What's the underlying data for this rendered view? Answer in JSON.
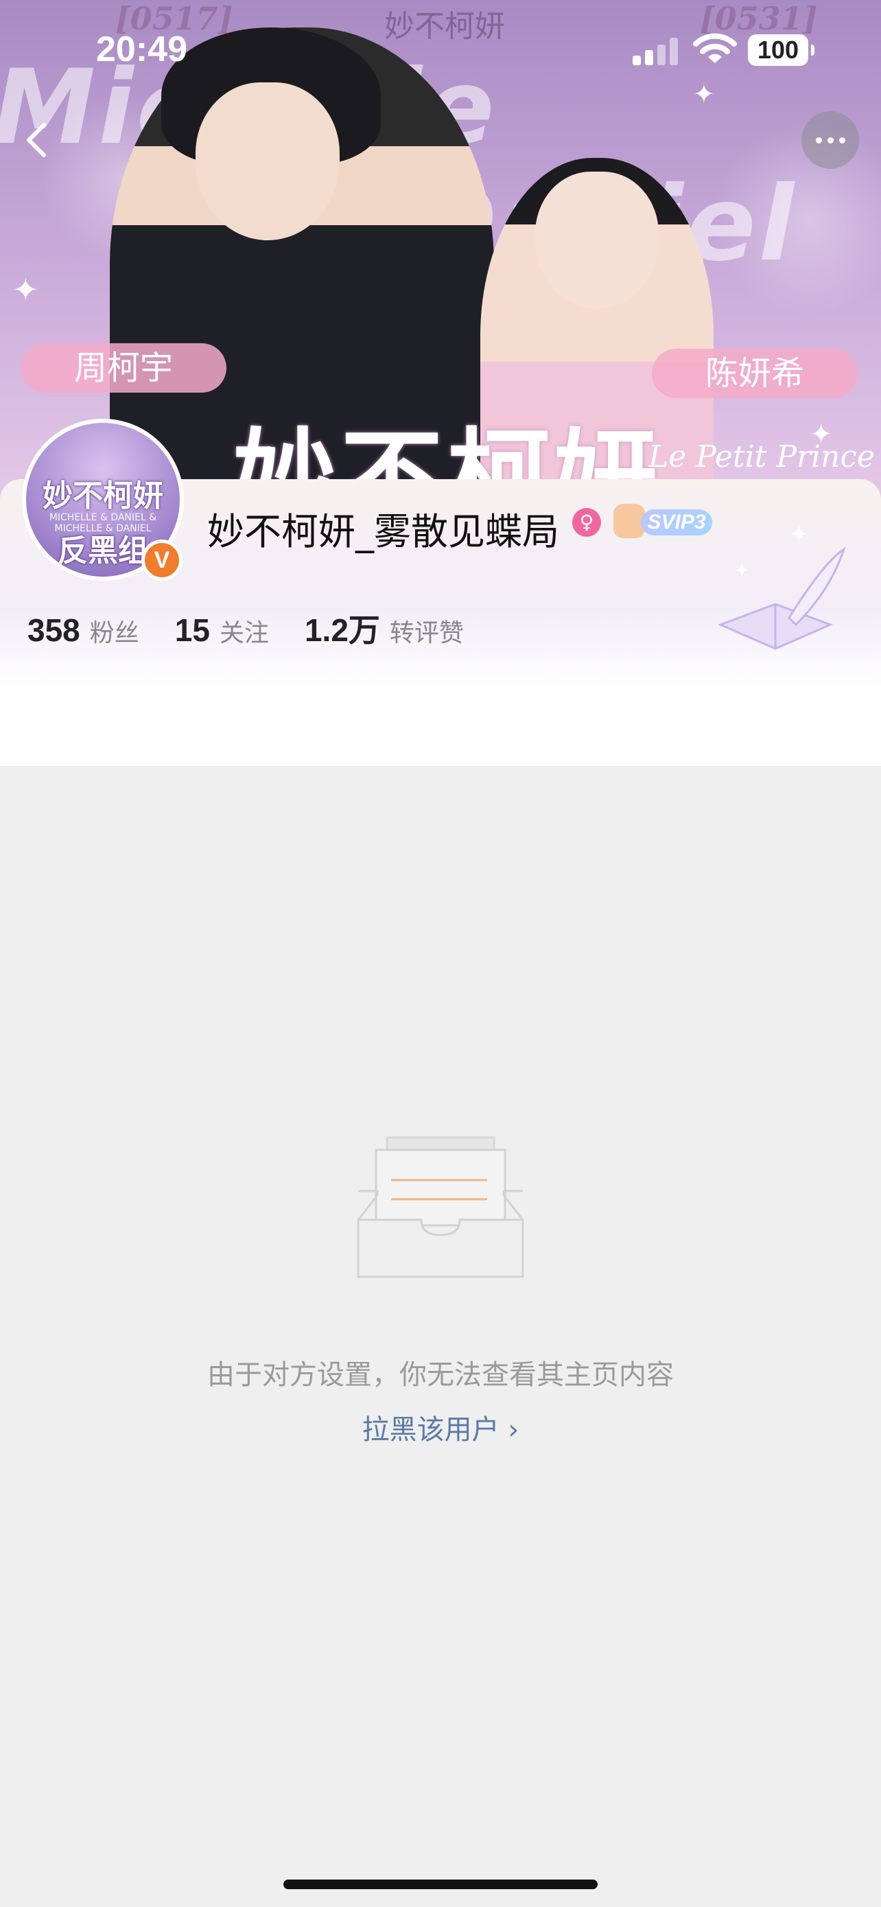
{
  "status_bar": {
    "time": "20:49",
    "battery": "100"
  },
  "banner": {
    "date_left": "[0517]",
    "date_right": "[0531]",
    "top_title": "妙不柯妍",
    "bg_name_1": "Michelle",
    "bg_name_2": "Daniel",
    "tag_left": "周柯宇",
    "tag_right": "陈妍希",
    "big_title": "妙不柯妍",
    "subtitle": "Le Petit Prince"
  },
  "avatar": {
    "line1": "妙不柯妍",
    "line_small": "MICHELLE & DANIEL & MICHELLE & DANIEL",
    "line2": "反黑组",
    "verify": "V"
  },
  "profile": {
    "username": "妙不柯妍_雾散见蝶局",
    "vip_label": "SVIP3",
    "stats": [
      {
        "value": "358",
        "label": "粉丝"
      },
      {
        "value": "15",
        "label": "关注"
      },
      {
        "value": "1.2万",
        "label": "转评赞"
      }
    ]
  },
  "empty_state": {
    "message": "由于对方设置，你无法查看其主页内容",
    "block_link": "拉黑该用户 ›"
  },
  "colors": {
    "link": "#5b7aa6",
    "verify_badge": "#f07c2d",
    "gender_icon": "#f067a0",
    "background": "#efefef"
  },
  "icons": {
    "back": "chevron-left-icon",
    "more": "more-dots-icon",
    "gender": "female-icon",
    "empty": "empty-inbox-icon"
  }
}
